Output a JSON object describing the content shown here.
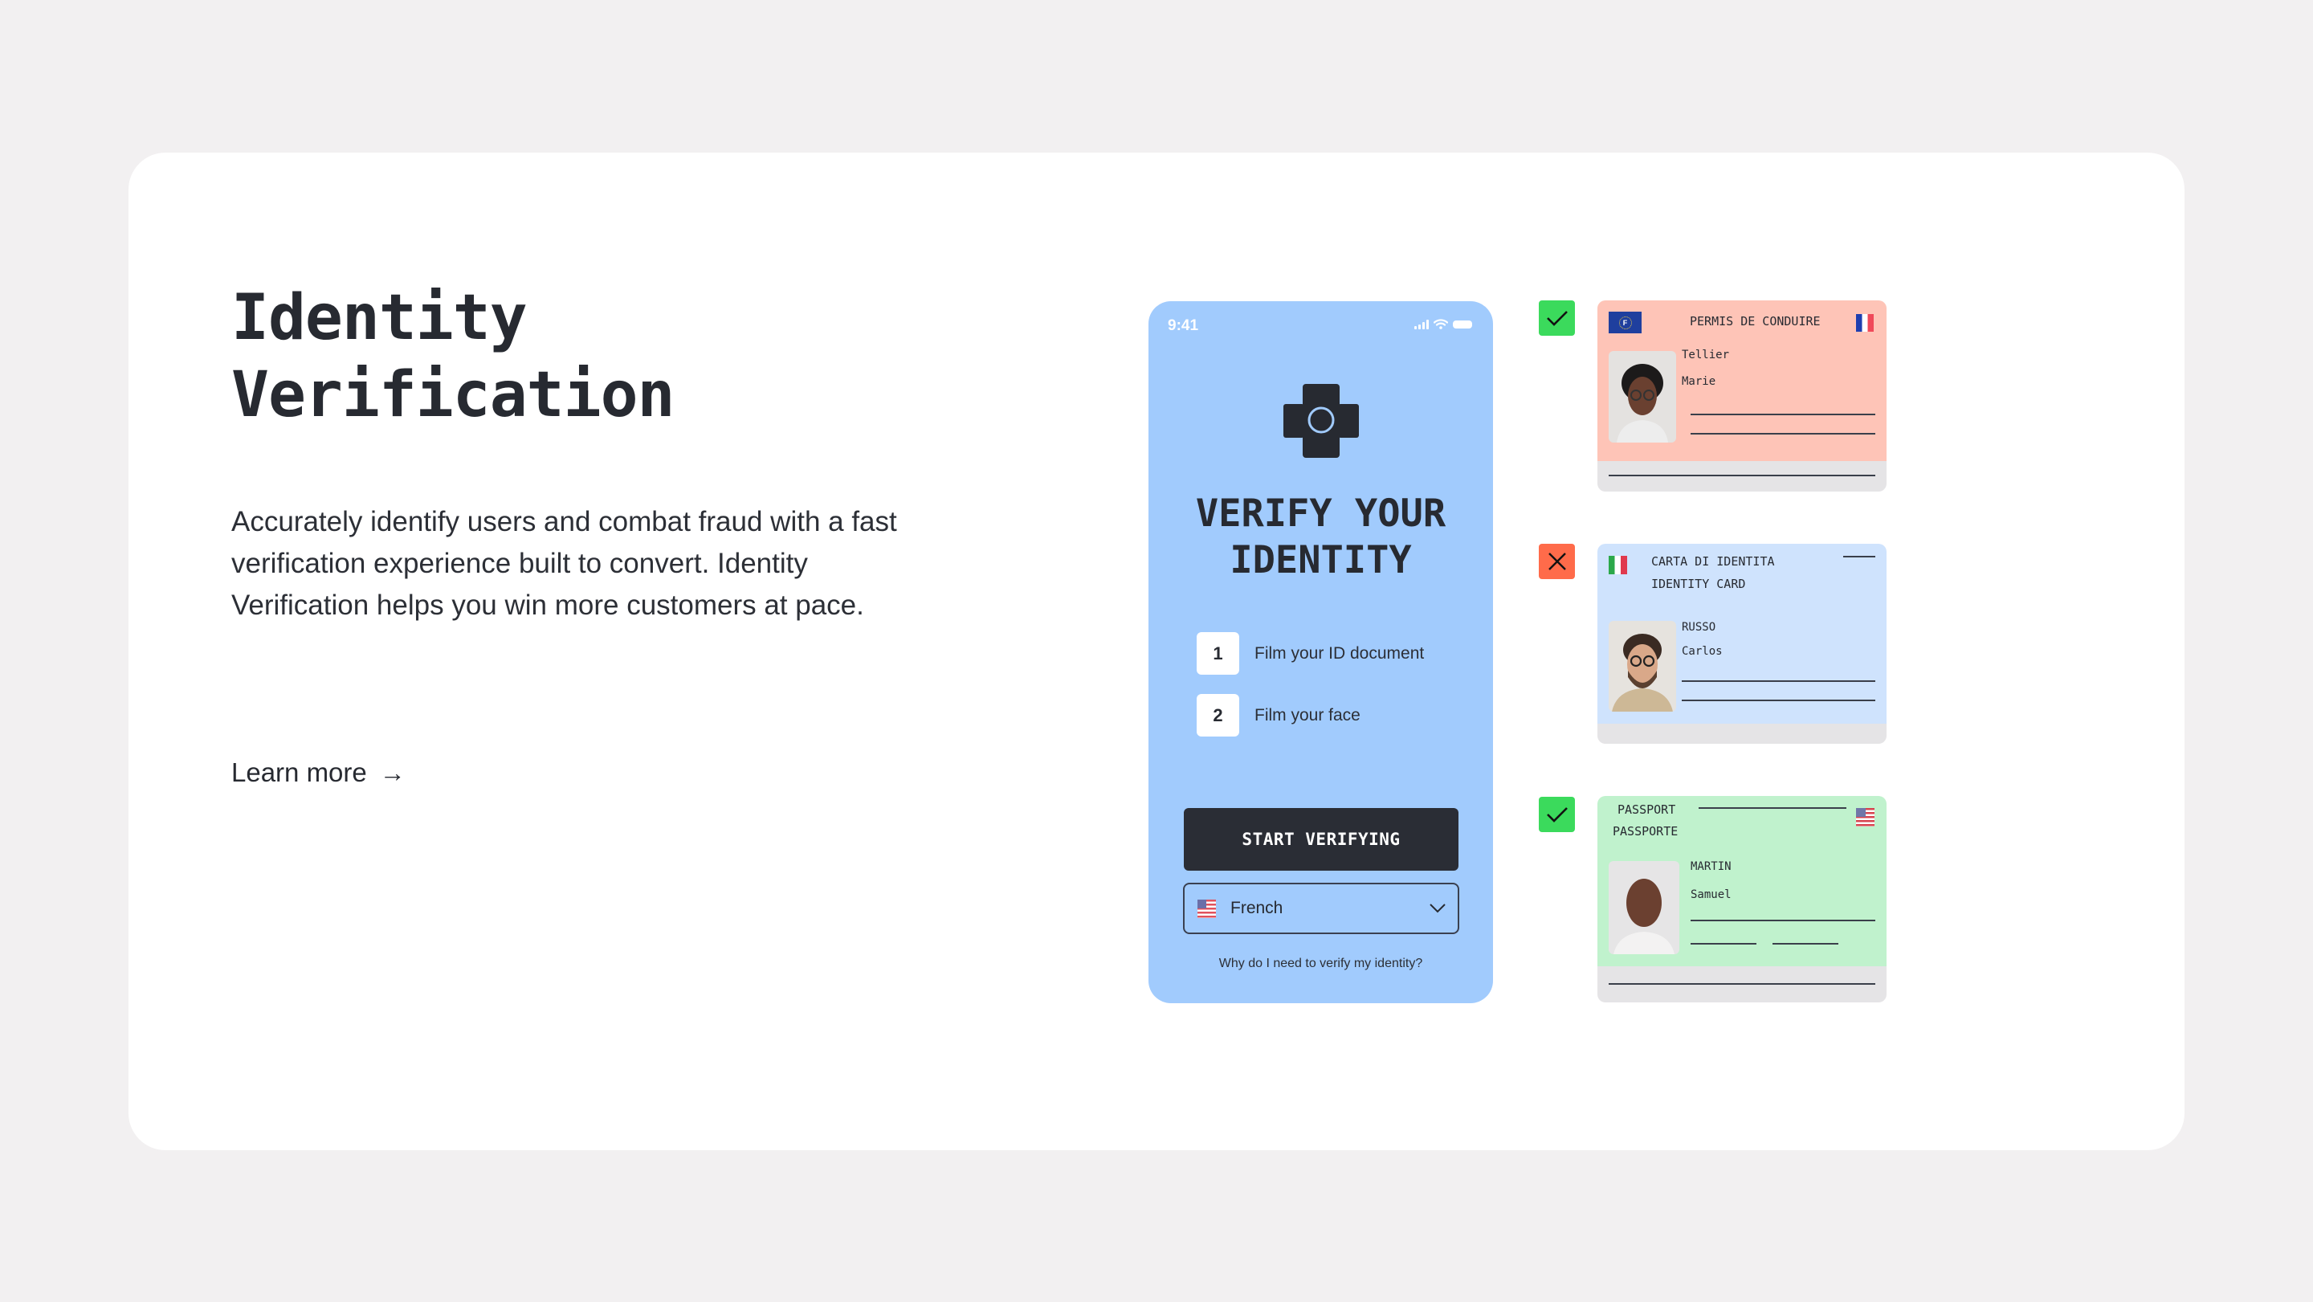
{
  "hero": {
    "title_line1": "Identity",
    "title_line2": "Verification",
    "description": "Accurately identify users and combat fraud with a fast verification experience built to convert. Identity Verification helps you win more customers at pace.",
    "learn_more_label": "Learn more",
    "learn_more_icon": "arrow-right-icon",
    "learn_more_arrow": "→"
  },
  "phone": {
    "status_time": "9:41",
    "status_icons": [
      "signal-icon",
      "wifi-icon",
      "battery-icon"
    ],
    "icon": "camera-phone-icon",
    "heading_line1": "VERIFY YOUR",
    "heading_line2": "IDENTITY",
    "steps": [
      {
        "number": "1",
        "label": "Film your ID document"
      },
      {
        "number": "2",
        "label": "Film your face"
      }
    ],
    "start_button_label": "START VERIFYING",
    "language_select": {
      "value": "French",
      "flag": "us-flag-icon"
    },
    "help_link": "Why do I need to verify my identity?",
    "background_color": "#A1CBFD"
  },
  "documents": [
    {
      "status": "accepted",
      "status_icon": "check-icon",
      "type": "PERMIS DE CONDUIRE",
      "surname": "Tellier",
      "given_name": "Marie",
      "flags": [
        "eu-flag-icon",
        "france-flag-icon"
      ],
      "eu_letter": "F",
      "color": "#FEC4B7"
    },
    {
      "status": "rejected",
      "status_icon": "x-icon",
      "type_line1": "CARTA DI IDENTITA",
      "type_line2": "IDENTITY CARD",
      "surname": "RUSSO",
      "given_name": "Carlos",
      "flags": [
        "italy-flag-icon"
      ],
      "color": "#CFE3FD"
    },
    {
      "status": "accepted",
      "status_icon": "check-icon",
      "type_line1": "PASSPORT",
      "type_line2": "PASSPORTE",
      "surname": "MARTIN",
      "given_name": "Samuel",
      "flags": [
        "us-flag-icon"
      ],
      "color": "#C0F2CD"
    }
  ],
  "colors": {
    "page_background": "#F2F0F1",
    "card_background": "#FFFFFF",
    "text": "#272A31",
    "button": "#2A2D35",
    "success": "#3BDA5C",
    "error": "#FF6B4A"
  }
}
